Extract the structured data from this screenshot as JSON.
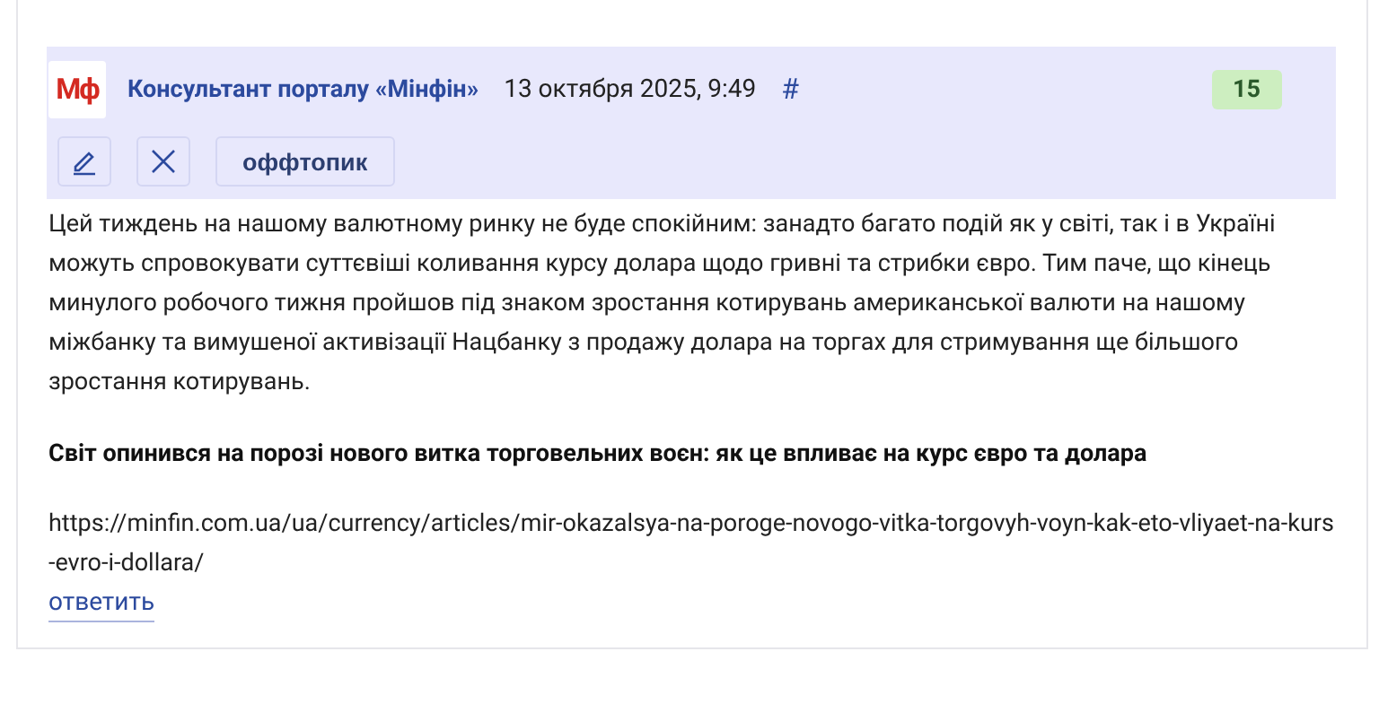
{
  "comment": {
    "logo": "Мф",
    "author": "Консультант порталу «Мінфін»",
    "date": "13 октября 2025, 9:49",
    "anchor": "#",
    "score": "15",
    "tools": [
      {
        "kind": "edit"
      },
      {
        "kind": "delete"
      },
      {
        "kind": "text",
        "label": "оффтопик"
      }
    ],
    "body": "Цей тиждень на нашому валютному ринку не буде спокійним: занадто багато подій як у світі, так і в Україні можуть спровокувати суттєвіші коливання курсу долара щодо гривні та стрибки євро. Тим паче, що кінець минулого робочого тижня пройшов під знаком зростання котирувань американської валюти на нашому міжбанку та вимушеної активізації Нацбанку з продажу долара на торгах для стримування ще більшого зростання котирувань.",
    "headline": "Світ опинився на порозі нового витка торговельних воєн: як це впливає на курс євро та долара",
    "link": "https://minfin.com.ua/ua/currency/articles/mir-okazalsya-na-poroge-novogo-vitka-torgovyh-voyn-kak-eto-vliyaet-na-kurs-evro-i-dollara/",
    "reply": "ответить"
  }
}
